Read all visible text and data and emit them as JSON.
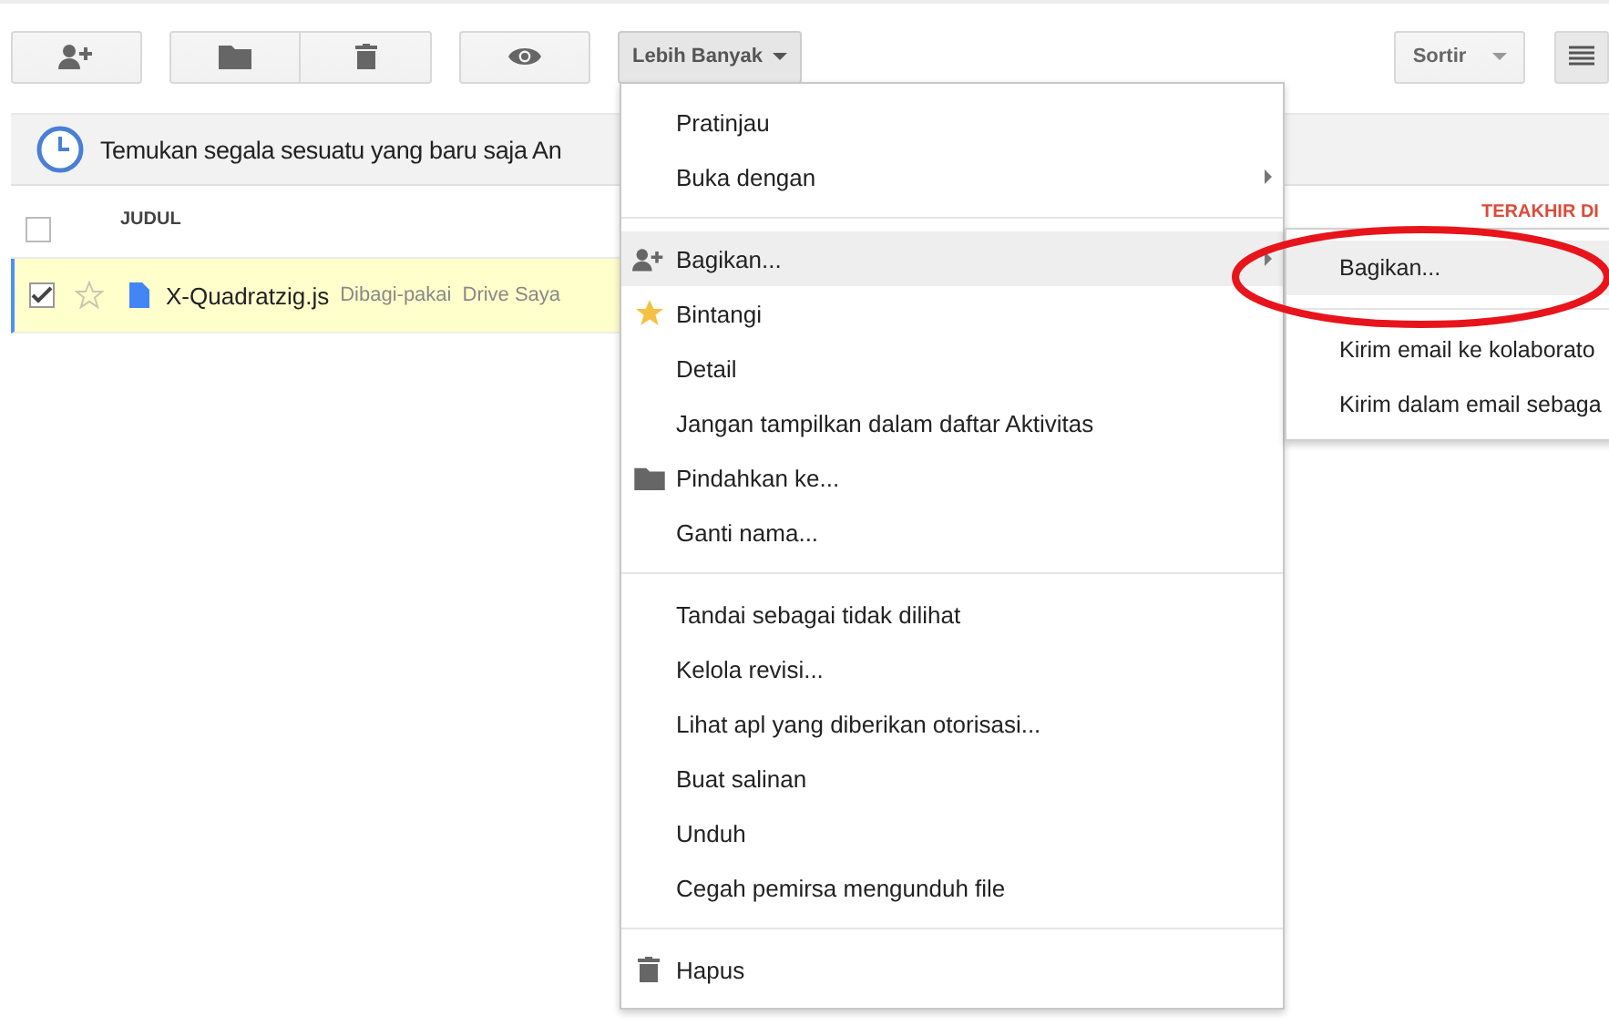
{
  "toolbar": {
    "more_button": {
      "label": "Lebih Banyak",
      "open": true
    },
    "sort_button": {
      "label": "Sortir"
    }
  },
  "banner": {
    "text": "Temukan segala sesuatu yang baru saja An"
  },
  "table": {
    "columns": [
      {
        "label": "JUDUL"
      },
      {
        "label": "TERAKHIR DI"
      }
    ],
    "select_all": {
      "checked": false
    },
    "rows": [
      {
        "name": "X-Quadratzig.js",
        "tags": [
          "Dibagi-pakai",
          "Drive Saya"
        ],
        "checked": true,
        "starred": false,
        "selected": true
      }
    ]
  },
  "menu": {
    "groups": [
      [
        {
          "label": "Pratinjau",
          "kind": "plain",
          "submenu": false,
          "selected": false
        },
        {
          "label": "Buka dengan",
          "kind": "plain",
          "submenu": true,
          "selected": false
        }
      ],
      [
        {
          "label": "Bagikan...",
          "kind": "share",
          "submenu": true,
          "selected": true
        },
        {
          "label": "Bintangi",
          "kind": "star",
          "submenu": false,
          "selected": false
        },
        {
          "label": "Detail",
          "kind": "plain",
          "submenu": false,
          "selected": false
        },
        {
          "label": "Jangan tampilkan dalam daftar Aktivitas",
          "kind": "plain",
          "submenu": false,
          "selected": false
        },
        {
          "label": "Pindahkan ke...",
          "kind": "move",
          "submenu": false,
          "selected": false
        },
        {
          "label": "Ganti nama...",
          "kind": "plain",
          "submenu": false,
          "selected": false
        }
      ],
      [
        {
          "label": "Tandai sebagai tidak dilihat",
          "kind": "plain",
          "submenu": false,
          "selected": false
        },
        {
          "label": "Kelola revisi...",
          "kind": "plain",
          "submenu": false,
          "selected": false
        },
        {
          "label": "Lihat apl yang diberikan otorisasi...",
          "kind": "plain",
          "submenu": false,
          "selected": false
        },
        {
          "label": "Buat salinan",
          "kind": "plain",
          "submenu": false,
          "selected": false
        },
        {
          "label": "Unduh",
          "kind": "plain",
          "submenu": false,
          "selected": false
        },
        {
          "label": "Cegah pemirsa mengunduh file",
          "kind": "plain",
          "submenu": false,
          "selected": false
        }
      ],
      [
        {
          "label": "Hapus",
          "kind": "delete",
          "submenu": false,
          "selected": false
        }
      ]
    ]
  },
  "submenu": {
    "groups": [
      [
        {
          "label": "Bagikan...",
          "selected": true
        }
      ],
      [
        {
          "label": "Kirim email ke kolaborato",
          "selected": false
        },
        {
          "label": "Kirim dalam email sebaga",
          "selected": false
        }
      ]
    ]
  }
}
